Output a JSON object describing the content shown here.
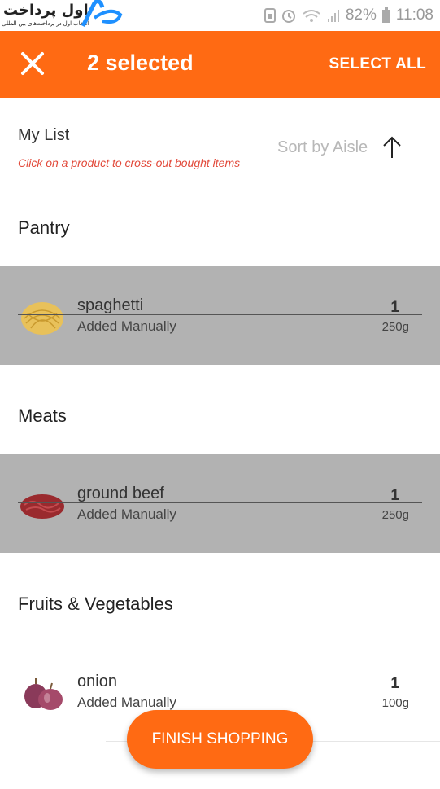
{
  "status_bar": {
    "logo_text": "اول پرداخت",
    "logo_subtitle": "انتخاب اول در پرداخت‌های بین المللی",
    "battery": "82%",
    "time": "11:08"
  },
  "header": {
    "selected_label": "2 selected",
    "select_all_label": "SELECT ALL"
  },
  "list": {
    "title": "My List",
    "hint": "Click on a product to cross-out bought items",
    "sort_label": "Sort by Aisle"
  },
  "sections": [
    {
      "name": "Pantry",
      "items": [
        {
          "name": "spaghetti",
          "source": "Added Manually",
          "qty": "1",
          "size": "250g",
          "crossed": true
        }
      ]
    },
    {
      "name": "Meats",
      "items": [
        {
          "name": "ground beef",
          "source": "Added Manually",
          "qty": "1",
          "size": "250g",
          "crossed": true
        }
      ]
    },
    {
      "name": "Fruits & Vegetables",
      "items": [
        {
          "name": "onion",
          "source": "Added Manually",
          "qty": "1",
          "size": "100g",
          "crossed": false
        }
      ]
    }
  ],
  "finish_label": "FINISH SHOPPING",
  "colors": {
    "accent": "#ff6a13",
    "crossed_bg": "#b2b2b2",
    "hint": "#e24a3b"
  },
  "icons": [
    "close-icon",
    "sort-up-arrow-icon",
    "alarm-icon",
    "wifi-icon",
    "signal-icon",
    "battery-icon"
  ]
}
